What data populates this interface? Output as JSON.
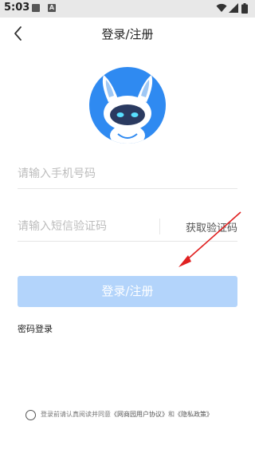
{
  "status_bar": {
    "time": "5:03",
    "a_icon_letter": "A"
  },
  "nav": {
    "title": "登录/注册"
  },
  "form": {
    "phone_placeholder": "请输入手机号码",
    "code_placeholder": "请输入短信验证码",
    "get_code_label": "获取验证码",
    "submit_label": "登录/注册",
    "password_login_label": "密码登录"
  },
  "agreement": {
    "prefix": "登录前请认真阅读并同意",
    "user_agreement": "《网商园用户协议》",
    "conjunction": "和",
    "privacy_policy": "《隐私政策》"
  },
  "colors": {
    "primary_disabled": "#b3d4fb",
    "avatar_bg": "#2f8af1",
    "annotation_arrow": "#e02020"
  },
  "icons": [
    "back-arrow-icon",
    "robot-rabbit-avatar",
    "wifi-icon",
    "signal-icon",
    "battery-icon",
    "radio-button"
  ]
}
